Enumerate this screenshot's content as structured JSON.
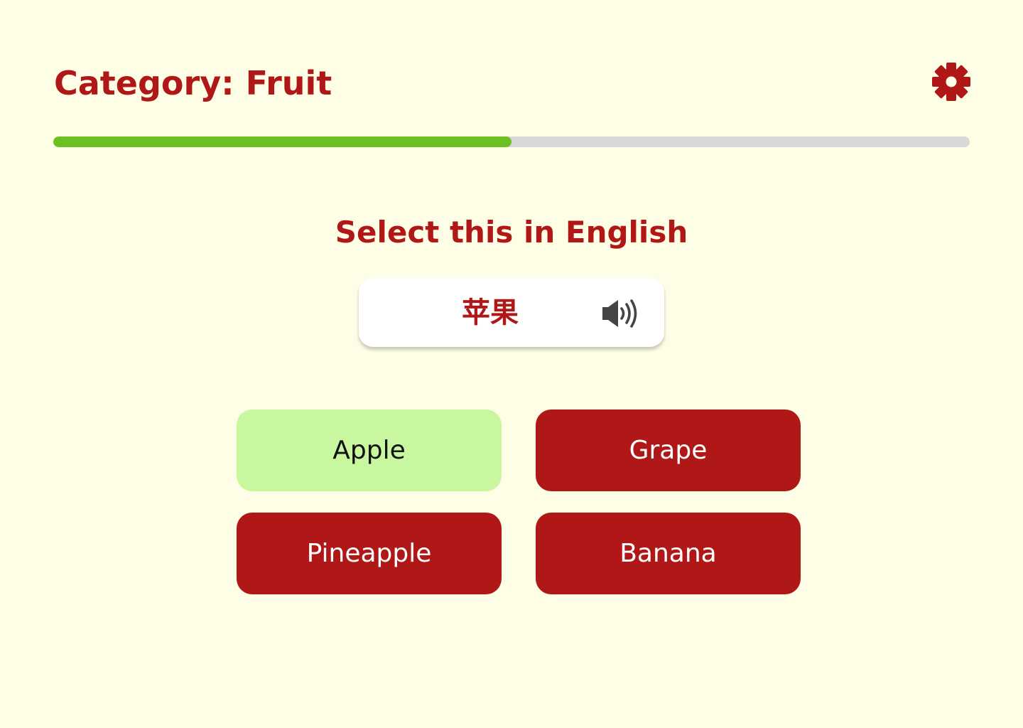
{
  "header": {
    "title": "Category: Fruit",
    "settings_icon": "gear-icon"
  },
  "progress": {
    "fraction": 0.5,
    "fill_color": "#6cc120",
    "track_color": "#d8d8d8"
  },
  "question": {
    "prompt": "Select this in English",
    "word": "苹果",
    "audio_icon": "speaker-icon"
  },
  "options": [
    {
      "label": "Apple",
      "state": "correct"
    },
    {
      "label": "Grape",
      "state": "default"
    },
    {
      "label": "Pineapple",
      "state": "default"
    },
    {
      "label": "Banana",
      "state": "default"
    }
  ],
  "colors": {
    "background": "#fefee6",
    "accent": "#b01818",
    "correct": "#c9f7a0"
  }
}
